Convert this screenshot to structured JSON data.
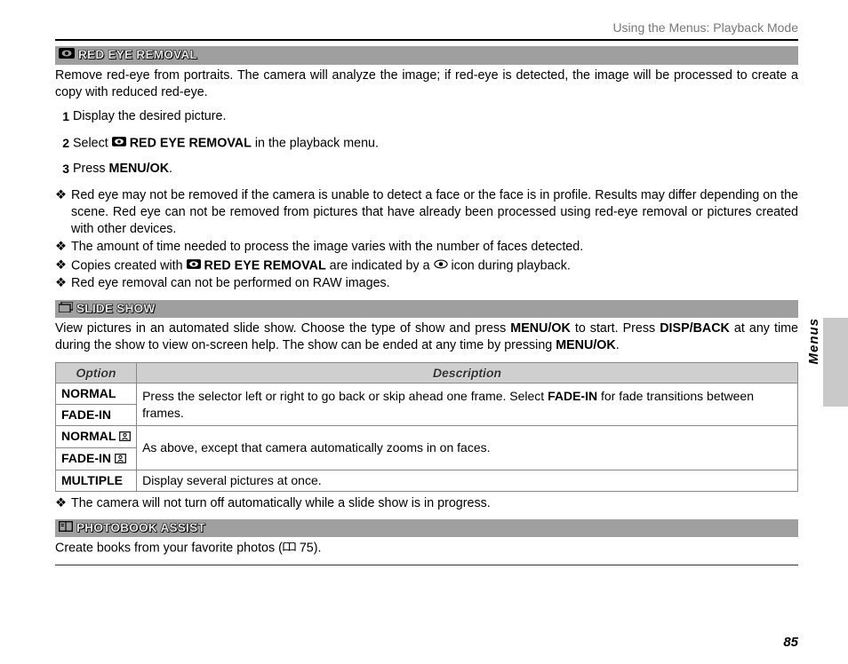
{
  "header": {
    "breadcrumb": "Using the Menus: Playback Mode"
  },
  "sideTab": "Menus",
  "pageNumber": "85",
  "sections": {
    "redEye": {
      "icon": "red-eye-removal-icon",
      "title": "RED EYE REMOVAL",
      "intro": "Remove red-eye from portraits.  The camera will analyze the image; if red-eye is detected, the image will be processed to create a copy with reduced red-eye.",
      "steps": [
        {
          "n": "1",
          "text_before": "Display the desired picture."
        },
        {
          "n": "2",
          "text_before": "Select ",
          "bold_with_icon": "RED EYE REMOVAL",
          "text_after": " in the playback menu."
        },
        {
          "n": "3",
          "text_before": "Press ",
          "bold": "MENU/OK",
          "text_after": "."
        }
      ],
      "notes": [
        "Red eye may not be removed if the camera is unable to detect a face or the face is in profile.  Results may differ depending on the scene.  Red eye can not be removed from pictures that have already been processed using red-eye removal or pictures created with other devices.",
        "The amount of time needed to process the image varies with the number of faces detected.",
        "__ICONLINE__",
        "Red eye removal can not be performed on RAW images."
      ],
      "note_icon_line": {
        "pre": "Copies created with ",
        "bold": "RED EYE REMOVAL",
        "mid": " are indicated by a ",
        "post": " icon during playback."
      }
    },
    "slideShow": {
      "icon": "slide-show-icon",
      "title": "SLIDE SHOW",
      "intro_parts": {
        "p1": "View pictures in an automated slide show.  Choose the type of show and press ",
        "b1": "MENU/OK",
        "p2": " to start.  Press ",
        "b2": "DISP/BACK",
        "p3": " at any time during the show to view on-screen help.  The show can be ended at any time by pressing ",
        "b3": "MENU/OK",
        "p4": "."
      },
      "table": {
        "headers": {
          "option": "Option",
          "description": "Description"
        },
        "rows": [
          {
            "option": "NORMAL",
            "group": 0
          },
          {
            "option": "FADE-IN",
            "group": 0
          },
          {
            "option": "NORMAL ",
            "group": 1,
            "face": true
          },
          {
            "option": "FADE-IN ",
            "group": 1,
            "face": true
          },
          {
            "option": "MULTIPLE",
            "group": 2
          }
        ],
        "descriptions": {
          "0_pre": "Press the selector left or right to go back or skip ahead one frame.  Select ",
          "0_bold": "FADE-IN",
          "0_post": " for fade transitions between frames.",
          "1": "As above, except that camera automatically zooms in on faces.",
          "2": "Display several pictures at once."
        }
      },
      "note": "The camera will not turn off automatically while a slide show is in progress."
    },
    "photobook": {
      "icon": "photobook-assist-icon",
      "title": "PHOTOBOOK ASSIST",
      "intro_pre": "Create books from your favorite photos (",
      "intro_ref": " 75).",
      "intro_icon": "book-ref-icon"
    }
  }
}
